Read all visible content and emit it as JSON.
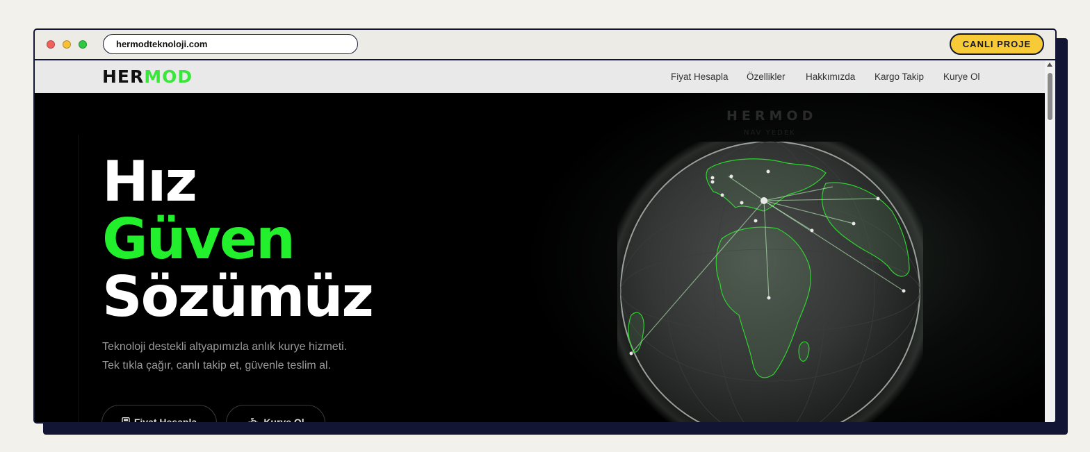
{
  "browser": {
    "url": "hermodteknoloji.com",
    "live_button": "CANLI PROJE"
  },
  "nav": {
    "logo_left": "HER",
    "logo_right": "MOD",
    "items": [
      "Fiyat Hesapla",
      "Özellikler",
      "Hakkımızda",
      "Kargo Takip",
      "Kurye Ol"
    ]
  },
  "hero": {
    "line1": "Hız",
    "line2": "Güven",
    "line3": "Sözümüz",
    "desc1": "Teknoloji destekli altyapımızla anlık kurye hizmeti.",
    "desc2": "Tek tıkla çağır, canlı takip et, güvenle teslim al.",
    "btn1": "Fiyat Hesapla",
    "btn2": "Kurye Ol",
    "watermark": "HERMOD",
    "watermark_sub": "NAV YEDEK"
  },
  "colors": {
    "accent_green": "#22f02c",
    "live_yellow": "#f7cb38",
    "frame_navy": "#121634"
  },
  "icons": [
    "calculator-icon",
    "courier-icon"
  ]
}
